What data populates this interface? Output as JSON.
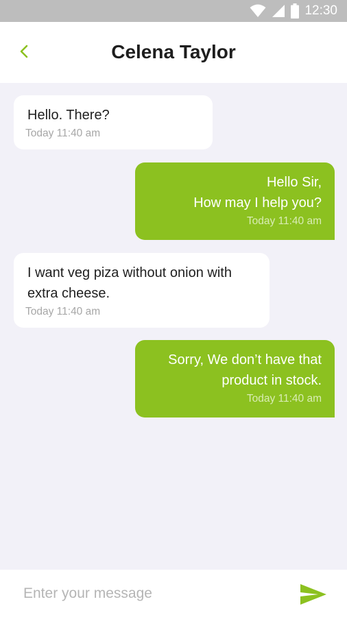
{
  "status_bar": {
    "time": "12:30",
    "icons": [
      "wifi-icon",
      "cellular-signal-icon",
      "battery-icon"
    ]
  },
  "header": {
    "back_icon": "chevron-left-icon",
    "title": "Celena Taylor"
  },
  "messages": [
    {
      "direction": "incoming",
      "text": "Hello. There?",
      "time": "Today  11:40 am"
    },
    {
      "direction": "outgoing",
      "text": "Hello Sir,\nHow may I help you?",
      "time": "Today  11:40 am"
    },
    {
      "direction": "incoming",
      "text": "I want veg piza without onion with\nextra cheese.",
      "time": "Today  11:40 am"
    },
    {
      "direction": "outgoing",
      "text": "Sorry, We don’t have that\nproduct in stock.",
      "time": "Today  11:40 am"
    }
  ],
  "composer": {
    "placeholder": "Enter your message",
    "value": "",
    "send_icon": "send-icon"
  },
  "colors": {
    "accent": "#8cc120",
    "status_bar": "#bdbdbd",
    "chat_background": "#f2f1f8"
  }
}
